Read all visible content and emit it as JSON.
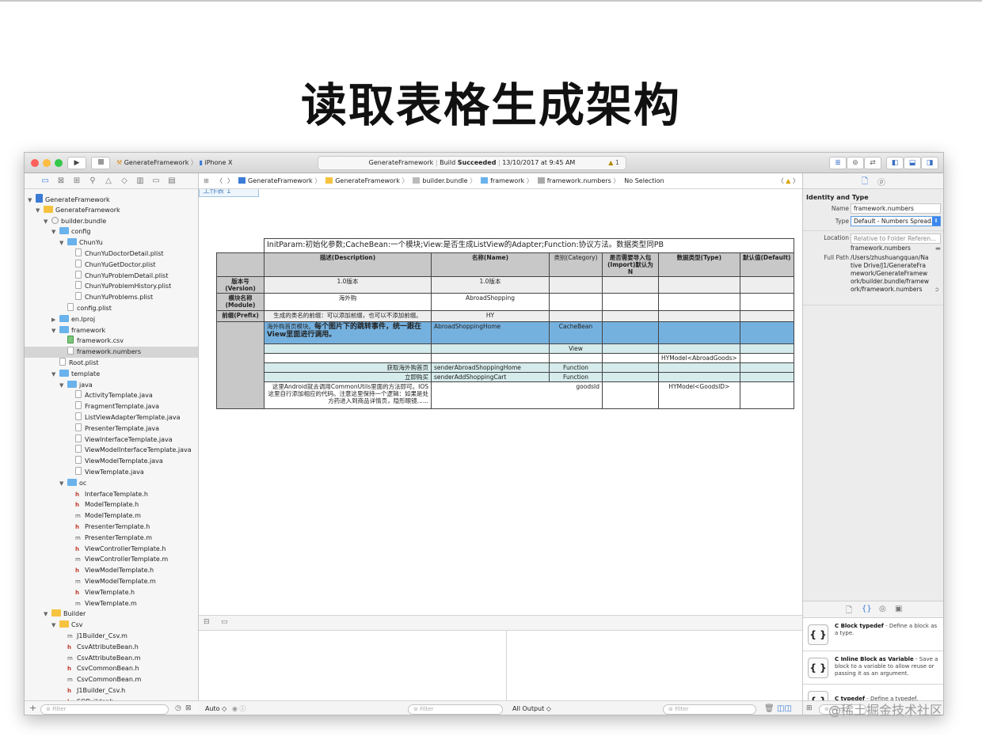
{
  "slide": {
    "title": "读取表格生成架构"
  },
  "toolbar": {
    "scheme": "GenerateFramework",
    "device": "iPhone X",
    "activity_project": "GenerateFramework",
    "activity_build": "Build",
    "activity_status": "Succeeded",
    "activity_time": "13/10/2017 at 9:45 AM",
    "warning_count": "1"
  },
  "tree": [
    {
      "d": 0,
      "t": "tri",
      "k": "blueproj",
      "label": "GenerateFramework"
    },
    {
      "d": 1,
      "t": "tri",
      "k": "folder-y",
      "label": "GenerateFramework"
    },
    {
      "d": 2,
      "t": "tri",
      "k": "bundle",
      "label": "builder.bundle"
    },
    {
      "d": 3,
      "t": "tri",
      "k": "folder",
      "label": "config"
    },
    {
      "d": 4,
      "t": "tri",
      "k": "folder",
      "label": "ChunYu"
    },
    {
      "d": 5,
      "t": "",
      "k": "file",
      "label": "ChunYuDoctorDetail.plist"
    },
    {
      "d": 5,
      "t": "",
      "k": "file",
      "label": "ChunYuGetDoctor.plist"
    },
    {
      "d": 5,
      "t": "",
      "k": "file",
      "label": "ChunYuProblemDetail.plist"
    },
    {
      "d": 5,
      "t": "",
      "k": "file",
      "label": "ChunYuProblemHistory.plist"
    },
    {
      "d": 5,
      "t": "",
      "k": "file",
      "label": "ChunYuProblems.plist"
    },
    {
      "d": 4,
      "t": "",
      "k": "file",
      "label": "config.plist"
    },
    {
      "d": 3,
      "t": "closed",
      "k": "folder",
      "label": "en.lproj"
    },
    {
      "d": 3,
      "t": "tri",
      "k": "folder",
      "label": "framework"
    },
    {
      "d": 4,
      "t": "",
      "k": "csv",
      "label": "framework.csv"
    },
    {
      "d": 4,
      "t": "",
      "k": "file",
      "label": "framework.numbers",
      "sel": true
    },
    {
      "d": 3,
      "t": "",
      "k": "file",
      "label": "Root.plist"
    },
    {
      "d": 3,
      "t": "tri",
      "k": "folder",
      "label": "template"
    },
    {
      "d": 4,
      "t": "tri",
      "k": "folder",
      "label": "java"
    },
    {
      "d": 5,
      "t": "",
      "k": "file",
      "label": "ActivityTemplate.java"
    },
    {
      "d": 5,
      "t": "",
      "k": "file",
      "label": "FragmentTemplate.java"
    },
    {
      "d": 5,
      "t": "",
      "k": "file",
      "label": "ListViewAdapterTemplate.java"
    },
    {
      "d": 5,
      "t": "",
      "k": "file",
      "label": "PresenterTemplate.java"
    },
    {
      "d": 5,
      "t": "",
      "k": "file",
      "label": "ViewInterfaceTemplate.java"
    },
    {
      "d": 5,
      "t": "",
      "k": "file",
      "label": "ViewModelInterfaceTemplate.java"
    },
    {
      "d": 5,
      "t": "",
      "k": "file",
      "label": "ViewModelTemplate.java"
    },
    {
      "d": 5,
      "t": "",
      "k": "file",
      "label": "ViewTemplate.java"
    },
    {
      "d": 4,
      "t": "tri",
      "k": "folder",
      "label": "oc"
    },
    {
      "d": 5,
      "t": "",
      "k": "h",
      "label": "InterfaceTemplate.h"
    },
    {
      "d": 5,
      "t": "",
      "k": "h",
      "label": "ModelTemplate.h"
    },
    {
      "d": 5,
      "t": "",
      "k": "m",
      "label": "ModelTemplate.m"
    },
    {
      "d": 5,
      "t": "",
      "k": "h",
      "label": "PresenterTemplate.h"
    },
    {
      "d": 5,
      "t": "",
      "k": "m",
      "label": "PresenterTemplate.m"
    },
    {
      "d": 5,
      "t": "",
      "k": "h",
      "label": "ViewControllerTemplate.h"
    },
    {
      "d": 5,
      "t": "",
      "k": "m",
      "label": "ViewControllerTemplate.m"
    },
    {
      "d": 5,
      "t": "",
      "k": "h",
      "label": "ViewModelTemplate.h"
    },
    {
      "d": 5,
      "t": "",
      "k": "m",
      "label": "ViewModelTemplate.m"
    },
    {
      "d": 5,
      "t": "",
      "k": "h",
      "label": "ViewTemplate.h"
    },
    {
      "d": 5,
      "t": "",
      "k": "m",
      "label": "ViewTemplate.m"
    },
    {
      "d": 2,
      "t": "tri",
      "k": "folder-y",
      "label": "Builder"
    },
    {
      "d": 3,
      "t": "tri",
      "k": "folder-y",
      "label": "Csv"
    },
    {
      "d": 4,
      "t": "",
      "k": "m",
      "label": "J1Builder_Csv.m"
    },
    {
      "d": 4,
      "t": "",
      "k": "h",
      "label": "CsvAttributeBean.h"
    },
    {
      "d": 4,
      "t": "",
      "k": "m",
      "label": "CsvAttributeBean.m"
    },
    {
      "d": 4,
      "t": "",
      "k": "h",
      "label": "CsvCommonBean.h"
    },
    {
      "d": 4,
      "t": "",
      "k": "m",
      "label": "CsvCommonBean.m"
    },
    {
      "d": 4,
      "t": "",
      "k": "h",
      "label": "J1Builder_Csv.h"
    },
    {
      "d": 4,
      "t": "",
      "k": "h",
      "label": "SQBuilder.h"
    }
  ],
  "left_footer": {
    "filter_placeholder": "Filter"
  },
  "jumpbar": {
    "crumbs": [
      "GenerateFramework",
      "GenerateFramework",
      "builder.bundle",
      "framework",
      "framework.numbers",
      "No Selection"
    ]
  },
  "sheet": {
    "tab": "工作表 1",
    "header_note": "InitParam:初始化参数;CacheBean:一个模块;View:是否生成ListView的Adapter;Function:协议方法。数据类型同PB",
    "cols": [
      "描述(Description)",
      "名称(Name)",
      "类别(Category)",
      "是否需要导入包(Import)默认为N",
      "数据类型(Type)",
      "默认值(Default)"
    ],
    "version_label": "版本号(Version)",
    "version_desc": "1.0版本",
    "version_name": "1.0版本",
    "module_label": "模块名称(Module)",
    "module_desc": "海外购",
    "module_name": "AbroadShopping",
    "prefix_label": "前缀(Prefix)",
    "prefix_desc": "生成的类名的前缀：可以添加前缀，也可以不添加前缀。",
    "prefix_name": "HY",
    "cb_desc_small": "海外购首页模块。",
    "cb_desc_big": "每个图片下的跳转事件，统一跟在View里面进行调用。",
    "cb_name": "AbroadShoppingHome",
    "cb_cat": "CacheBean",
    "view_cat": "View",
    "type_goods": "HYModel<AbroadGoods>",
    "f1_desc": "获取海外购首页",
    "f1_name": "senderAbroadShoppingHome",
    "f1_cat": "Function",
    "f2_desc": "立即购买",
    "f2_name": "senderAddShoppingCart",
    "f2_cat": "Function",
    "last_desc": "这里Android就去调用CommonUtils里面的方法即可。IOS这里自行添加相应的代码。注意这里保持一个逻辑：如果是处方药进入到商品详情页，隐形眼镜......",
    "last_name": "goodsId",
    "last_type": "HYModel<GoodsID>"
  },
  "debug": {
    "auto": "Auto ◇",
    "filter": "Filter",
    "all_output": "All Output ◇",
    "filter2": "Filter"
  },
  "inspector": {
    "section": "Identity and Type",
    "name_label": "Name",
    "name_value": "framework.numbers",
    "type_label": "Type",
    "type_value": "Default - Numbers Spread...",
    "location_label": "Location",
    "location_value": "Relative to Folder Referen...",
    "location_file": "framework.numbers",
    "fullpath_label": "Full Path",
    "fullpath_value": "/Users/zhushuangquan/Native Drive/J1/GenerateFramework/GenerateFramework/builder.bundle/framework/framework.numbers"
  },
  "library": [
    {
      "title": "C Block typedef",
      "desc": " - Define a block as a type."
    },
    {
      "title": "C Inline Block as Variable",
      "desc": " - Save a block to a variable to allow reuse or passing it as an argument."
    },
    {
      "title": "C typedef",
      "desc": " - Define a typedef."
    }
  ],
  "right_footer": {
    "filter": "Filter"
  },
  "watermark": "@稀土掘金技术社区"
}
